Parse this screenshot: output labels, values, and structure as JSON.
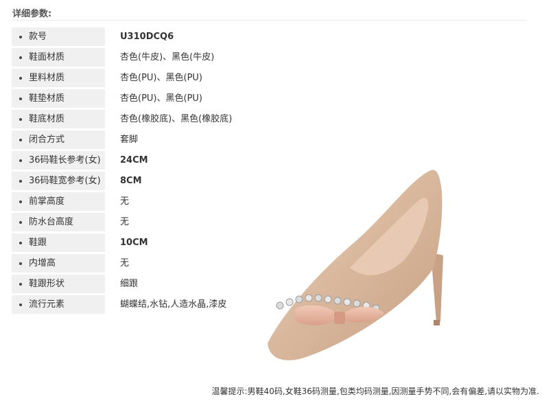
{
  "header": {
    "title": "详细参数:"
  },
  "specs": [
    {
      "label": "款号",
      "value": "U310DCQ6"
    },
    {
      "label": "鞋面材质",
      "value": "杏色(牛皮)、黑色(牛皮)"
    },
    {
      "label": "里料材质",
      "value": "杏色(PU)、黑色(PU)"
    },
    {
      "label": "鞋垫材质",
      "value": "杏色(PU)、黑色(PU)"
    },
    {
      "label": "鞋底材质",
      "value": "杏色(橡胶底)、黑色(橡胶底)"
    },
    {
      "label": "闭合方式",
      "value": "套脚"
    },
    {
      "label": "36码鞋长参考(女)",
      "value": "24CM"
    },
    {
      "label": "36码鞋宽参考(女)",
      "value": "8CM"
    },
    {
      "label": "前掌高度",
      "value": "无"
    },
    {
      "label": "防水台高度",
      "value": "无"
    },
    {
      "label": "鞋跟",
      "value": "10CM"
    },
    {
      "label": "内增高",
      "value": "无"
    },
    {
      "label": "鞋跟形状",
      "value": "细跟"
    },
    {
      "label": "流行元素",
      "value": "蝴蝶结,水钻,人造水晶,漆皮"
    }
  ],
  "footnote": "温馨提示:男鞋40码,女鞋36码测量,包类均码测量,因测量手势不同,会有偏差,请以实物为准.",
  "colors": {
    "label_bg": "#f0f0f0",
    "shoe": "#d8b79c",
    "bow": "#e8b5a0",
    "heel": "#c9a184"
  }
}
